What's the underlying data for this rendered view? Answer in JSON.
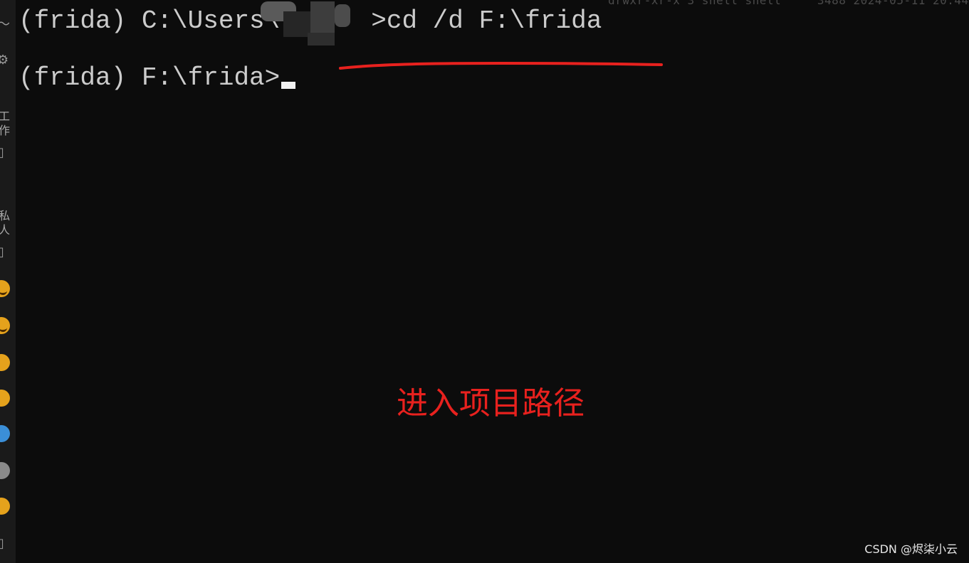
{
  "background_ghost_text": "drwxr-xr-x 3 shell shell     3488 2024-05-11 20:44",
  "sidebar": {
    "labels": [
      "工作",
      "私人"
    ],
    "icons": [
      "chart-icon",
      "gear-icon",
      "document-icon",
      "document-icon",
      "grinning-face-icon",
      "grinning-face-icon",
      "emoji-icon",
      "emoji-icon",
      "emoji-icon",
      "emoji-icon",
      "emoji-icon",
      "document-icon"
    ]
  },
  "terminal": {
    "line1_prefix": "(frida) C:\\Users\\",
    "line1_command": ">cd /d F:\\frida",
    "line2_prompt": "(frida) F:\\frida>"
  },
  "annotation": {
    "text": "进入项目路径",
    "color": "#e8211e"
  },
  "watermark": "CSDN @烬柒小云",
  "colors": {
    "terminal_bg": "#0c0c0c",
    "terminal_text": "#cccccc",
    "annotation_red": "#e8211e"
  }
}
